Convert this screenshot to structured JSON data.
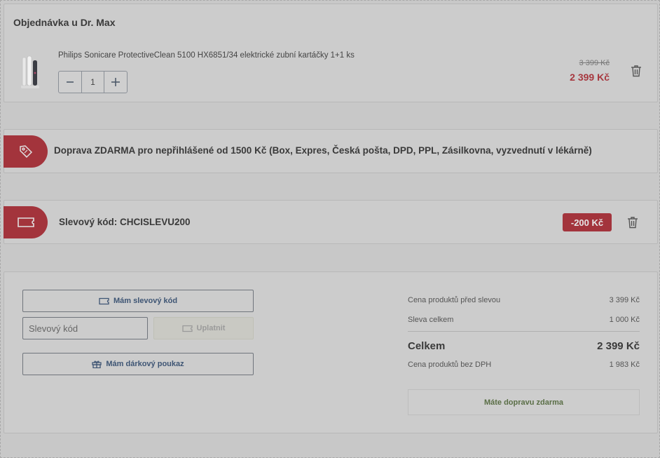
{
  "order": {
    "title": "Objednávka u Dr. Max",
    "product": {
      "name": "Philips Sonicare ProtectiveClean 5100 HX6851/34 elektrické zubní kartáčky 1+1 ks",
      "quantity": "1",
      "old_price": "3 399 Kč",
      "new_price": "2 399 Kč"
    },
    "icons": {
      "minus": "minus-icon",
      "plus": "plus-icon",
      "delete": "trash-icon"
    }
  },
  "shipping_banner": {
    "text": "Doprava ZDARMA pro nepřihlášené od 1500 Kč (Box, Expres, Česká pošta, DPD, PPL, Zásilkovna, vyzvednutí v lékárně)",
    "icon": "tag-icon"
  },
  "voucher": {
    "label": "Slevový kód: CHCISLEVU200",
    "badge": "-200 Kč",
    "icon": "ticket-icon"
  },
  "promo": {
    "voucher_button": "Mám slevový kód",
    "code_placeholder": "Slevový kód",
    "apply_button": "Uplatnit",
    "gift_button": "Mám dárkový poukaz"
  },
  "summary": {
    "rows": [
      {
        "label": "Cena produktů před slevou",
        "value": "3 399 Kč"
      },
      {
        "label": "Sleva celkem",
        "value": "1 000 Kč"
      }
    ],
    "total_label": "Celkem",
    "total_value": "2 399 Kč",
    "net_label": "Cena produktů bez DPH",
    "net_value": "1 983 Kč",
    "free_shipping": "Máte dopravu zdarma"
  },
  "colors": {
    "accent": "#a3343c",
    "link": "#3e5574",
    "success": "#5a6e46"
  }
}
